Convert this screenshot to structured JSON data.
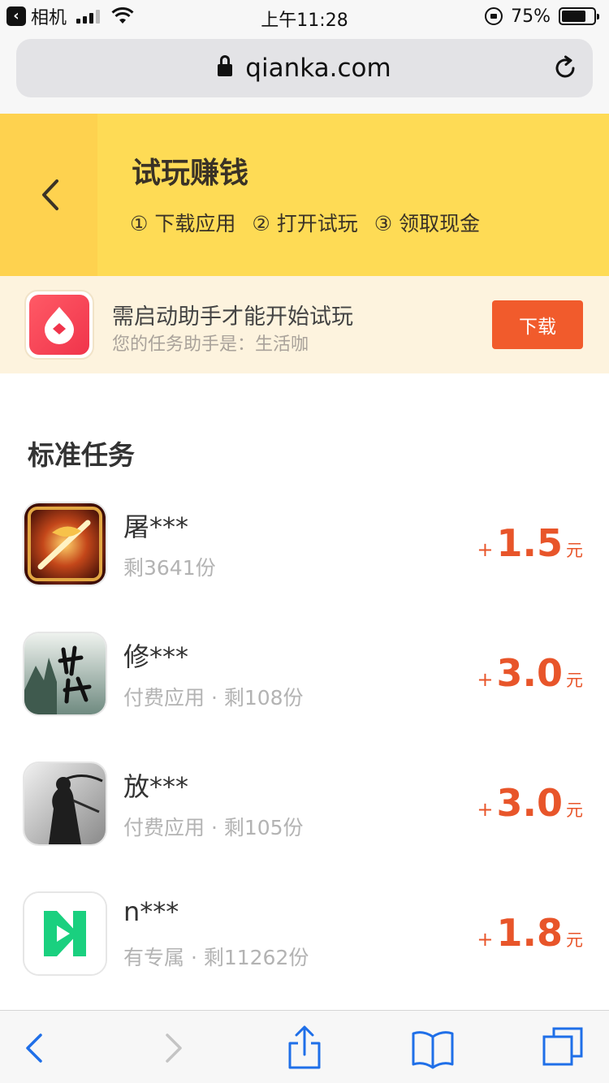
{
  "status_bar": {
    "back_app": "相机",
    "time": "上午11:28",
    "battery": "75%",
    "battery_level": 0.75
  },
  "browser": {
    "url": "qianka.com",
    "toolbar_icons": [
      "back-icon",
      "forward-icon",
      "share-icon",
      "bookmarks-icon",
      "tabs-icon"
    ]
  },
  "header": {
    "title": "试玩赚钱",
    "steps": [
      "① 下载应用",
      "② 打开试玩",
      "③ 领取现金"
    ]
  },
  "helper": {
    "title": "需启动助手才能开始试玩",
    "subtitle": "您的任务助手是：生活咖",
    "button": "下载"
  },
  "section_title": "标准任务",
  "tasks": [
    {
      "name": "屠***",
      "meta": "剩3641份",
      "plus": "+",
      "amount": "1.5",
      "unit": "元",
      "icon": "game-dragon-icon"
    },
    {
      "name": "修***",
      "meta": "付费应用 · 剩108份",
      "plus": "+",
      "amount": "3.0",
      "unit": "元",
      "icon": "game-xianxia-icon"
    },
    {
      "name": "放***",
      "meta": "付费应用 · 剩105份",
      "plus": "+",
      "amount": "3.0",
      "unit": "元",
      "icon": "game-swordsman-icon"
    },
    {
      "name": "n***",
      "meta": "有专属 · 剩11262份",
      "plus": "+",
      "amount": "1.8",
      "unit": "元",
      "icon": "app-n-logo-icon"
    }
  ],
  "colors": {
    "header_yellow": "#fedb55",
    "accent_orange": "#f15b2c",
    "reward_red": "#e8552a",
    "helper_bg": "#fdf3de"
  }
}
